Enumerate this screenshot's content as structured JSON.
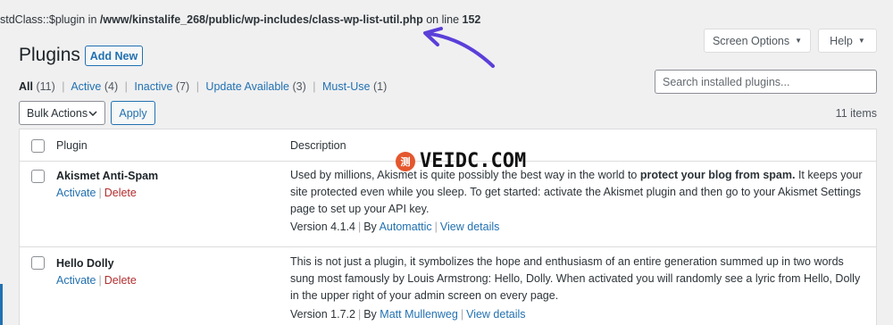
{
  "notice": {
    "prefix": "stdClass::$plugin in ",
    "path": "/www/kinstalife_268/public/wp-includes/class-wp-list-util.php",
    "middle": " on line ",
    "line": "152"
  },
  "header": {
    "screen_options_label": "Screen Options",
    "help_label": "Help",
    "title": "Plugins",
    "add_new_label": "Add New"
  },
  "filters": [
    {
      "label": "All",
      "count": "(11)"
    },
    {
      "label": "Active",
      "count": "(4)"
    },
    {
      "label": "Inactive",
      "count": "(7)"
    },
    {
      "label": "Update Available",
      "count": "(3)"
    },
    {
      "label": "Must-Use",
      "count": "(1)"
    }
  ],
  "search": {
    "placeholder": "Search installed plugins..."
  },
  "bulk": {
    "select_label": "Bulk Actions",
    "apply_label": "Apply",
    "items_count": "11 items"
  },
  "table": {
    "col_plugin": "Plugin",
    "col_description": "Description",
    "rows": [
      {
        "name": "Akismet Anti-Spam",
        "activate": "Activate",
        "delete": "Delete",
        "desc_1": "Used by millions, Akismet is quite possibly the best way in the world to ",
        "desc_bold": "protect your blog from spam.",
        "desc_2": " It keeps your site protected even while you sleep. To get started: activate the Akismet plugin and then go to your Akismet Settings page to set up your API key.",
        "version": "Version 4.1.4",
        "by": "By ",
        "author": "Automattic",
        "view_details": "View details"
      },
      {
        "name": "Hello Dolly",
        "activate": "Activate",
        "delete": "Delete",
        "desc": "This is not just a plugin, it symbolizes the hope and enthusiasm of an entire generation summed up in two words sung most famously by Louis Armstrong: Hello, Dolly. When activated you will randomly see a lyric from Hello, Dolly in the upper right of your admin screen on every page.",
        "version": "Version 1.7.2",
        "by": "By ",
        "author": "Matt Mullenweg",
        "view_details": "View details"
      }
    ]
  },
  "watermark": {
    "badge": "测",
    "text": "VEIDC.COM"
  },
  "colors": {
    "link": "#2271b1",
    "delete": "#b32d2e",
    "arrow": "#5b3fd9"
  }
}
